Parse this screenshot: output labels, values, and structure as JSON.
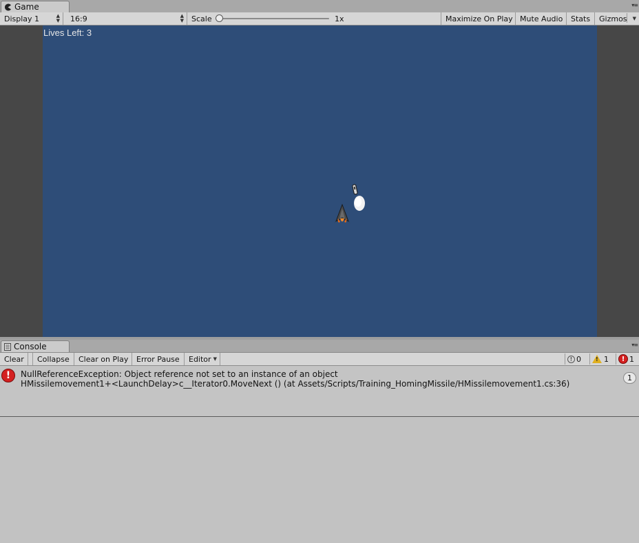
{
  "game_tab": {
    "label": "Game",
    "menu": "▾≡"
  },
  "game_toolbar": {
    "display": "Display 1",
    "aspect": "16:9",
    "scale_label": "Scale",
    "scale_value": "1x",
    "maximize_on_play": "Maximize On Play",
    "mute_audio": "Mute Audio",
    "stats": "Stats",
    "gizmos": "Gizmos"
  },
  "game_view": {
    "lives_text": "Lives Left: 3",
    "background_color": "#2e4d78"
  },
  "console_tab": {
    "label": "Console",
    "menu": "▾≡"
  },
  "console_toolbar": {
    "clear": "Clear",
    "collapse": "Collapse",
    "clear_on_play": "Clear on Play",
    "error_pause": "Error Pause",
    "editor": "Editor",
    "info_count": "0",
    "warning_count": "1",
    "error_count": "1"
  },
  "console_messages": [
    {
      "type": "error",
      "line1": "NullReferenceException: Object reference not set to an instance of an object",
      "line2": "HMissilemovement1+<LaunchDelay>c__Iterator0.MoveNext () (at Assets/Scripts/Training_HomingMissile/HMissilemovement1.cs:36)",
      "count": "1"
    }
  ],
  "icons": {
    "game_tab": "pacman-icon",
    "console_tab": "console-icon",
    "info": "info-icon",
    "warning": "warning-icon",
    "error": "error-icon"
  }
}
